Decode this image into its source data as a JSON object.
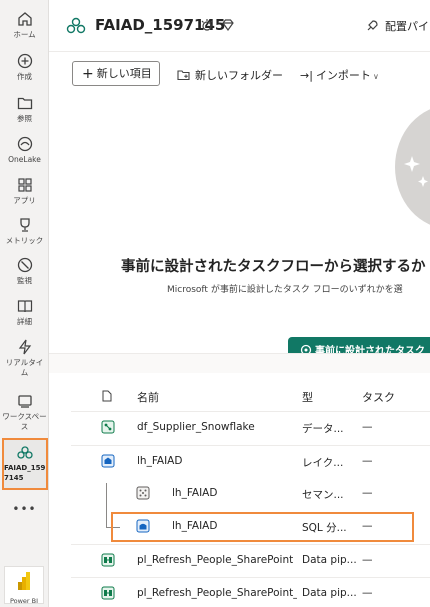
{
  "rail": {
    "items": [
      {
        "label": "ホーム",
        "icon": "home-icon"
      },
      {
        "label": "作成",
        "icon": "create-icon"
      },
      {
        "label": "参照",
        "icon": "browse-icon"
      },
      {
        "label": "OneLake",
        "icon": "onelake-icon"
      },
      {
        "label": "アプリ",
        "icon": "apps-icon"
      },
      {
        "label": "メトリック",
        "icon": "metrics-icon"
      },
      {
        "label": "監視",
        "icon": "monitor-icon"
      },
      {
        "label": "詳細",
        "icon": "learn-icon"
      },
      {
        "label": "リアルタイム",
        "icon": "realtime-icon"
      },
      {
        "label": "ワークスペース",
        "icon": "workspaces-icon"
      }
    ],
    "active": {
      "label": "FAIAD_1597145",
      "icon": "workspace-icon"
    },
    "more": "•••",
    "powerbi_label": "Power BI"
  },
  "header": {
    "title": "FAIAD_1597145",
    "right_label": "配置パイ"
  },
  "toolbar": {
    "new_item": "新しい項目",
    "new_folder": "新しいフォルダー",
    "import": "インポート"
  },
  "banner": {
    "title": "事前に設計されたタスクフローから選択するか",
    "subtitle": "Microsoft が事前に設計したタスク フローのいずれかを選",
    "button": "事前に設計されたタスク"
  },
  "table": {
    "headers": {
      "name": "名前",
      "type": "型",
      "task": "タスク"
    },
    "rows": [
      {
        "name": "df_Supplier_Snowflake",
        "type": "データ...",
        "task": "—",
        "icon": "dataflow-icon",
        "color": "#0f7b4b"
      },
      {
        "name": "lh_FAIAD",
        "type": "レイク...",
        "task": "—",
        "icon": "lakehouse-icon",
        "color": "#1565c0"
      },
      {
        "name": "lh_FAIAD",
        "type": "セマン...",
        "task": "—",
        "icon": "semantic-model-icon",
        "color": "#605e5c"
      },
      {
        "name": "lh_FAIAD",
        "type": "SQL 分...",
        "task": "—",
        "icon": "sql-endpoint-icon",
        "color": "#1565c0"
      },
      {
        "name": "pl_Refresh_People_SharePoint",
        "type": "Data pip...",
        "task": "—",
        "icon": "pipeline-icon",
        "color": "#0f7b4b"
      },
      {
        "name": "pl_Refresh_People_SharePoint_Opt",
        "type": "Data pip...",
        "task": "—",
        "icon": "pipeline-icon",
        "color": "#0f7b4b"
      }
    ]
  },
  "colors": {
    "highlight": "#f08a3c",
    "accent": "#117865",
    "rail_bg": "#f3f2f1"
  }
}
